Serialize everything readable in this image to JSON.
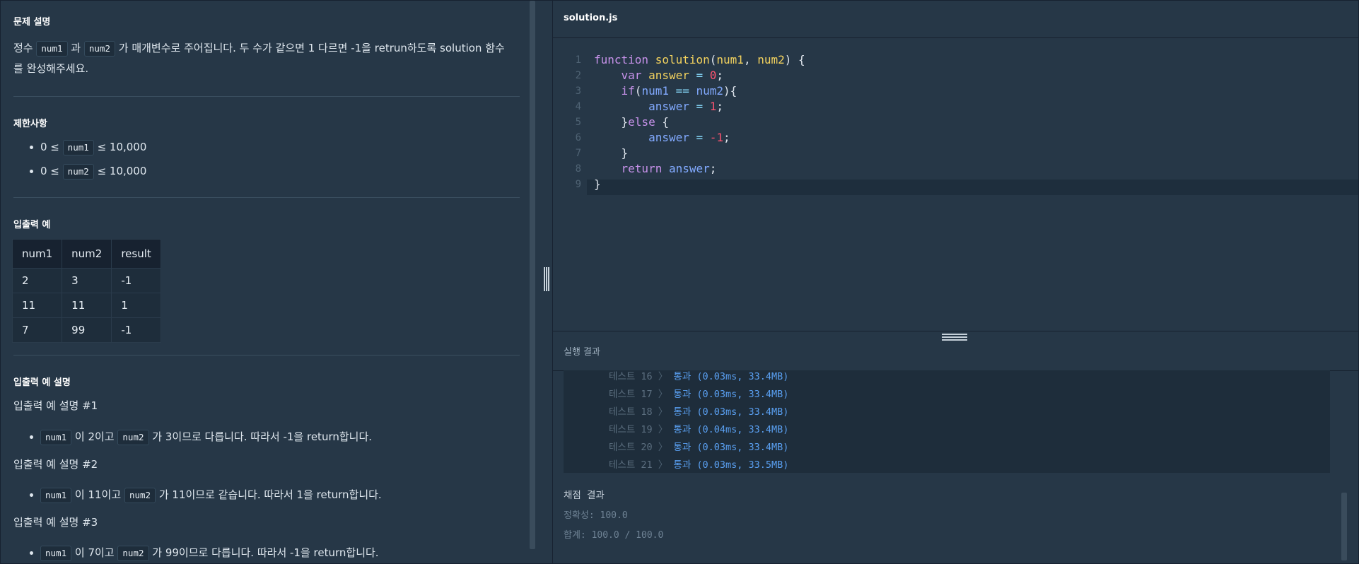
{
  "problem": {
    "title": "문제 설명",
    "desc_prefix": "정수",
    "code_num1": "num1",
    "desc_and": "과",
    "code_num2": "num2",
    "desc_line1_rest": "가 매개변수로 주어집니다. 두 수가 같으면 1 다르면 -1을 retrun하도록 solution 함수",
    "desc_line2": "를 완성해주세요."
  },
  "constraints": {
    "title": "제한사항",
    "items": [
      {
        "pre": "0 ≤",
        "code": "num1",
        "post": "≤ 10,000"
      },
      {
        "pre": "0 ≤",
        "code": "num2",
        "post": "≤ 10,000"
      }
    ]
  },
  "examples": {
    "title": "입출력 예",
    "headers": [
      "num1",
      "num2",
      "result"
    ],
    "rows": [
      [
        "2",
        "3",
        "-1"
      ],
      [
        "11",
        "11",
        "1"
      ],
      [
        "7",
        "99",
        "-1"
      ]
    ]
  },
  "explanations": {
    "title": "입출력 예 설명",
    "items": [
      {
        "heading": "입출력 예 설명 #1",
        "code1": "num1",
        "mid": "이 2이고",
        "code2": "num2",
        "rest": "가 3이므로 다릅니다. 따라서 -1을 return합니다."
      },
      {
        "heading": "입출력 예 설명 #2",
        "code1": "num1",
        "mid": "이 11이고",
        "code2": "num2",
        "rest": "가 11이므로 같습니다. 따라서 1을 return합니다."
      },
      {
        "heading": "입출력 예 설명 #3",
        "code1": "num1",
        "mid": "이 7이고",
        "code2": "num2",
        "rest": "가 99이므로 다릅니다. 따라서 -1을 return합니다."
      }
    ]
  },
  "editor": {
    "tab": "solution.js",
    "line_numbers": [
      "1",
      "2",
      "3",
      "4",
      "5",
      "6",
      "7",
      "8",
      "9"
    ],
    "code": {
      "l1": {
        "kw": "function",
        "fn": "solution",
        "p1": "(",
        "a1": "num1",
        "c": ", ",
        "a2": "num2",
        "p2": ") {"
      },
      "l2": {
        "kw": "var",
        "v": "answer",
        "op": " = ",
        "n": "0",
        "e": ";"
      },
      "l3": {
        "kw": "if",
        "p1": "(",
        "a": "num1",
        "op": " == ",
        "b": "num2",
        "p2": "){"
      },
      "l4": {
        "v": "answer",
        "op": " = ",
        "n": "1",
        "e": ";"
      },
      "l5": {
        "p": "}",
        "kw": "else",
        "e": " {"
      },
      "l6": {
        "v": "answer",
        "op": " = ",
        "n": "-1",
        "e": ";"
      },
      "l7": {
        "p": "}"
      },
      "l8": {
        "kw": "return",
        "v": "answer",
        "e": ";"
      },
      "l9": {
        "p": "}"
      }
    }
  },
  "output": {
    "title": "실행 결과",
    "tests": [
      {
        "label": "테스트 16",
        "result": "통과 (0.03ms, 33.4MB)"
      },
      {
        "label": "테스트 17",
        "result": "통과 (0.03ms, 33.4MB)"
      },
      {
        "label": "테스트 18",
        "result": "통과 (0.03ms, 33.4MB)"
      },
      {
        "label": "테스트 19",
        "result": "통과 (0.04ms, 33.4MB)"
      },
      {
        "label": "테스트 20",
        "result": "통과 (0.03ms, 33.4MB)"
      },
      {
        "label": "테스트 21",
        "result": "통과 (0.03ms, 33.5MB)"
      }
    ],
    "grade_title": "채점 결과",
    "accuracy": "정확성: 100.0",
    "total": "합계: 100.0 / 100.0"
  }
}
